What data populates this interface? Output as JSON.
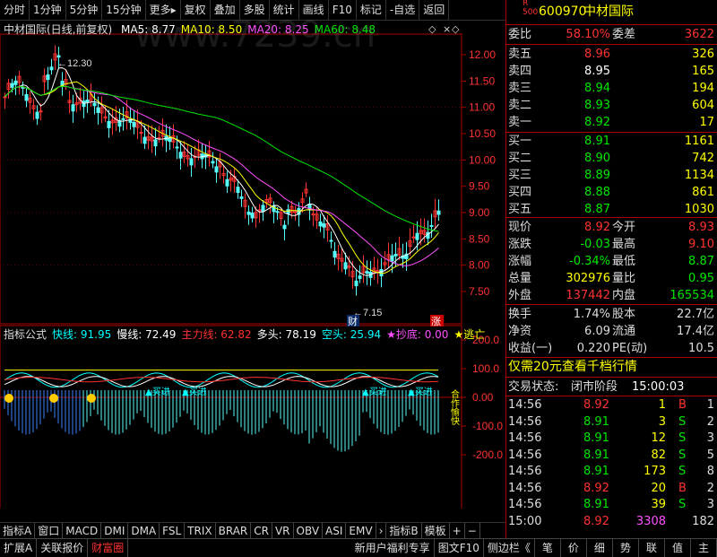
{
  "toolbar": {
    "items": [
      "分时",
      "1分钟",
      "5分钟",
      "15分钟",
      "更多▸",
      "复权",
      "叠加",
      "多股",
      "统计",
      "画线",
      "F10",
      "标记",
      "-自选",
      "返回"
    ]
  },
  "watermark": "www.7239.cn",
  "chart": {
    "title": "中材国际(日线,前复权)",
    "ma": [
      {
        "label": "MA5: 8.77",
        "color": "#ffffff"
      },
      {
        "label": "MA10: 8.50",
        "color": "#ffff00"
      },
      {
        "label": "MA20: 8.25",
        "color": "#ff50ff"
      },
      {
        "label": "MA60: 8.48",
        "color": "#00e600"
      }
    ],
    "price_ticks": [
      "12.00",
      "11.50",
      "11.00",
      "10.50",
      "10.00",
      "9.50",
      "9.00",
      "8.50",
      "8.00",
      "7.50"
    ],
    "high_label": "12.30",
    "low_label": "7.15",
    "marker_cai": "财",
    "marker_zhang": "涨",
    "indicator_ticks": [
      "200.0",
      "100.0",
      "0.00",
      "-100.0",
      "-200.0"
    ],
    "indicator_legend": [
      {
        "label": "指标公式",
        "color": "#dddddd"
      },
      {
        "label": "快线: 91.95",
        "color": "#00ffff"
      },
      {
        "label": "慢线: 72.49",
        "color": "#ffffff"
      },
      {
        "label": "主力线: 62.82",
        "color": "#ff3232"
      },
      {
        "label": "多头: 78.19",
        "color": "#ffffff"
      },
      {
        "label": "空头: 25.94",
        "color": "#00ffff"
      },
      {
        "label": "★抄底: 0.00",
        "color": "#ff50ff"
      },
      {
        "label": "★逃亡",
        "color": "#ffff00"
      }
    ],
    "signal_labels": [
      "▲买进",
      "▲买进",
      "▲买进",
      "▲买进"
    ],
    "signal_side": "合作愉快",
    "time_axis": [
      "2021年",
      "1",
      "2",
      "3",
      "4",
      "5",
      "6"
    ],
    "period": "日线"
  },
  "bottom_tabs": [
    "指标A",
    "窗口",
    "MACD",
    "DMI",
    "DMA",
    "FSL",
    "TRIX",
    "BRAR",
    "CR",
    "VR",
    "OBV",
    "ASI",
    "EMV",
    "›",
    "指标B",
    "模板",
    "+",
    "−"
  ],
  "bottom_bar": [
    "扩展A",
    "关联报价",
    "财富圈",
    "新用户福利专享",
    "图文F10",
    "侧边栏《",
    "笔",
    "价",
    "细",
    "势",
    "联",
    "值",
    "主"
  ],
  "quote": {
    "badge_top": "R",
    "badge_bottom": "500",
    "code": "600970",
    "name": "中材国际",
    "weibi_label": "委比",
    "weibi_value": "58.10%",
    "weicha_label": "委差",
    "weicha_value": "3622",
    "sell": [
      {
        "label": "卖五",
        "price": "8.96",
        "vol": "326"
      },
      {
        "label": "卖四",
        "price": "8.95",
        "vol": "165"
      },
      {
        "label": "卖三",
        "price": "8.94",
        "vol": "194"
      },
      {
        "label": "卖二",
        "price": "8.93",
        "vol": "604"
      },
      {
        "label": "卖一",
        "price": "8.92",
        "vol": "17"
      }
    ],
    "buy": [
      {
        "label": "买一",
        "price": "8.91",
        "vol": "1161"
      },
      {
        "label": "买二",
        "price": "8.90",
        "vol": "742"
      },
      {
        "label": "买三",
        "price": "8.89",
        "vol": "1134"
      },
      {
        "label": "买四",
        "price": "8.88",
        "vol": "861"
      },
      {
        "label": "买五",
        "price": "8.87",
        "vol": "1030"
      }
    ],
    "stats": [
      {
        "l1": "现价",
        "v1": "8.92",
        "c1": "#ff3232",
        "l2": "今开",
        "v2": "8.93",
        "c2": "#ff3232"
      },
      {
        "l1": "涨跌",
        "v1": "-0.03",
        "c1": "#00e600",
        "l2": "最高",
        "v2": "9.10",
        "c2": "#ff3232"
      },
      {
        "l1": "涨幅",
        "v1": "-0.34%",
        "c1": "#00e600",
        "l2": "最低",
        "v2": "8.87",
        "c2": "#00e600"
      },
      {
        "l1": "总量",
        "v1": "302976",
        "c1": "#ffff00",
        "l2": "量比",
        "v2": "0.95",
        "c2": "#00e600"
      },
      {
        "l1": "外盘",
        "v1": "137442",
        "c1": "#ff3232",
        "l2": "内盘",
        "v2": "165534",
        "c2": "#00e600"
      }
    ],
    "stats2": [
      {
        "l1": "换手",
        "v1": "1.74%",
        "l2": "股本",
        "v2": "22.7亿"
      },
      {
        "l1": "净资",
        "v1": "6.09",
        "l2": "流通",
        "v2": "17.4亿"
      },
      {
        "l1": "收益(一)",
        "v1": "0.220",
        "l2": "PE(动)",
        "v2": "10.5"
      }
    ],
    "promo": "仅需20元查看千档行情",
    "status_label": "交易状态:",
    "status_value": "闭市阶段",
    "status_time": "15:00:03",
    "trades": [
      {
        "t": "14:56",
        "p": "8.92",
        "pc": "#ff3232",
        "v": "1",
        "vc": "#ffff00",
        "s": "B",
        "sc": "#ff3232",
        "n": "1"
      },
      {
        "t": "14:56",
        "p": "8.91",
        "pc": "#00e600",
        "v": "3",
        "vc": "#ffff00",
        "s": "S",
        "sc": "#00e600",
        "n": "2"
      },
      {
        "t": "14:56",
        "p": "8.91",
        "pc": "#00e600",
        "v": "12",
        "vc": "#ffff00",
        "s": "S",
        "sc": "#00e600",
        "n": "3"
      },
      {
        "t": "14:56",
        "p": "8.91",
        "pc": "#00e600",
        "v": "82",
        "vc": "#ffff00",
        "s": "S",
        "sc": "#00e600",
        "n": "5"
      },
      {
        "t": "14:56",
        "p": "8.91",
        "pc": "#00e600",
        "v": "173",
        "vc": "#ffff00",
        "s": "S",
        "sc": "#00e600",
        "n": "8"
      },
      {
        "t": "14:56",
        "p": "8.92",
        "pc": "#ff3232",
        "v": "20",
        "vc": "#ffff00",
        "s": "B",
        "sc": "#ff3232",
        "n": "2"
      },
      {
        "t": "14:56",
        "p": "8.91",
        "pc": "#00e600",
        "v": "39",
        "vc": "#ffff00",
        "s": "S",
        "sc": "#00e600",
        "n": "3"
      },
      {
        "t": "15:00",
        "p": "8.92",
        "pc": "#ff3232",
        "v": "3308",
        "vc": "#ff50ff",
        "s": "",
        "sc": "#ddd",
        "n": "182"
      }
    ]
  }
}
